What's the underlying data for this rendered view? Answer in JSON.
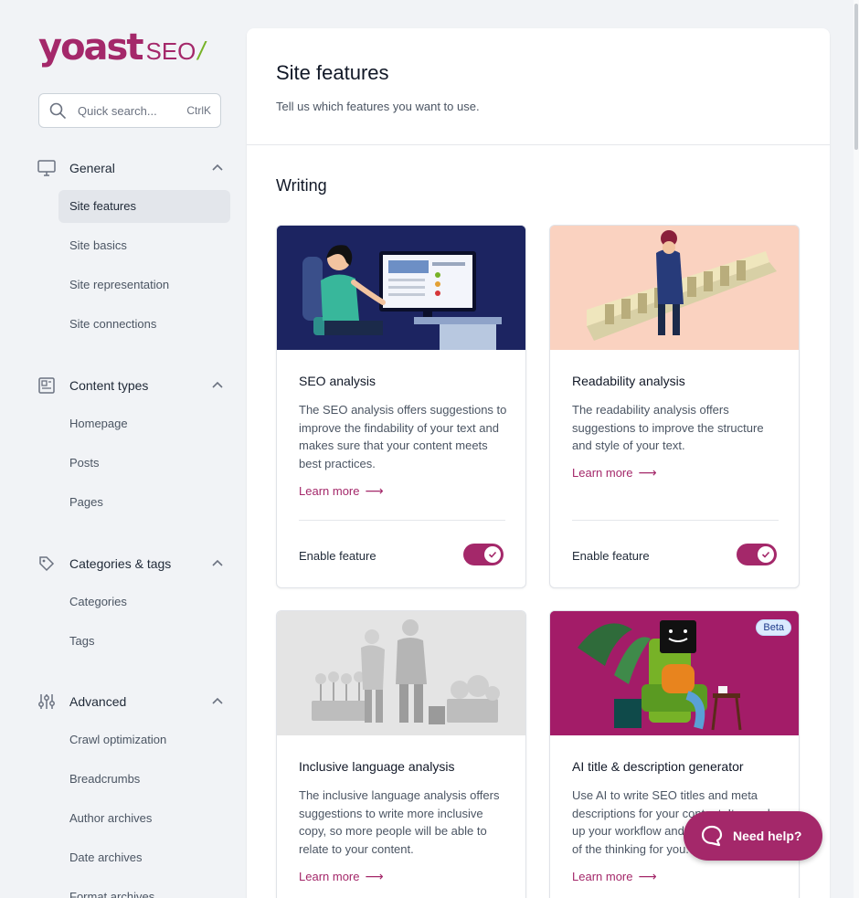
{
  "logo": {
    "word": "yoast",
    "product": "SEO",
    "slash": "/"
  },
  "search": {
    "placeholder": "Quick search...",
    "shortcut": "CtrlK"
  },
  "nav": {
    "general": {
      "label": "General",
      "items": [
        "Site features",
        "Site basics",
        "Site representation",
        "Site connections"
      ]
    },
    "content_types": {
      "label": "Content types",
      "items": [
        "Homepage",
        "Posts",
        "Pages"
      ]
    },
    "categories_tags": {
      "label": "Categories & tags",
      "items": [
        "Categories",
        "Tags"
      ]
    },
    "advanced": {
      "label": "Advanced",
      "items": [
        "Crawl optimization",
        "Breadcrumbs",
        "Author archives",
        "Date archives",
        "Format archives"
      ]
    }
  },
  "page": {
    "title": "Site features",
    "subtitle": "Tell us which features you want to use.",
    "section": "Writing"
  },
  "cards": [
    {
      "title": "SEO analysis",
      "description": "The SEO analysis offers suggestions to improve the findability of your text and makes sure that your content meets best practices.",
      "learn_more": "Learn more",
      "enable_label": "Enable feature",
      "enabled": true
    },
    {
      "title": "Readability analysis",
      "description": "The readability analysis offers suggestions to improve the structure and style of your text.",
      "learn_more": "Learn more",
      "enable_label": "Enable feature",
      "enabled": true
    },
    {
      "title": "Inclusive language analysis",
      "description": "The inclusive language analysis offers suggestions to write more inclusive copy, so more people will be able to relate to your content.",
      "learn_more": "Learn more"
    },
    {
      "title": "AI title & description generator",
      "description": "Use AI to write SEO titles and meta descriptions for your content. It speeds up your workflow and takes away some of the thinking for you.",
      "learn_more": "Learn more",
      "badge": "Beta"
    }
  ],
  "help_button": "Need help?",
  "colors": {
    "brand": "#a4286a",
    "accent_green": "#77b227",
    "active_nav_bg": "#e3e6eb"
  },
  "icons": [
    "search-icon",
    "monitor-icon",
    "document-icon",
    "tag-icon",
    "sliders-icon",
    "chevron-up-icon",
    "check-icon",
    "arrow-right-icon",
    "chat-bubble-icon"
  ]
}
